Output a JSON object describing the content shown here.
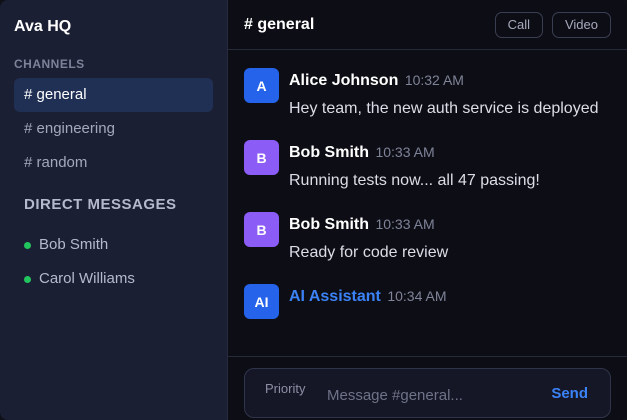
{
  "workspace": {
    "name": "Ava HQ"
  },
  "sidebar": {
    "channels_label": "CHANNELS",
    "channels": [
      {
        "label": "# general",
        "active": true
      },
      {
        "label": "# engineering",
        "active": false
      },
      {
        "label": "# random",
        "active": false
      }
    ],
    "dm_label": "DIRECT MESSAGES",
    "direct_messages": [
      {
        "name": "Bob Smith",
        "status_color": "#22c55e"
      },
      {
        "name": "Carol Williams",
        "status_color": "#22c55e"
      }
    ]
  },
  "header": {
    "title": "# general",
    "call_label": "Call",
    "video_label": "Video"
  },
  "messages": [
    {
      "initials": "A",
      "avatar_color": "#2563eb",
      "author": "Alice Johnson",
      "time": "10:32 AM",
      "text": "Hey team, the new auth service is deployed",
      "is_ai": false
    },
    {
      "initials": "B",
      "avatar_color": "#8b5cf6",
      "author": "Bob Smith",
      "time": "10:33 AM",
      "text": "Running tests now... all 47 passing!",
      "is_ai": false
    },
    {
      "initials": "B",
      "avatar_color": "#8b5cf6",
      "author": "Bob Smith",
      "time": "10:33 AM",
      "text": "Ready for code review",
      "is_ai": false
    },
    {
      "initials": "AI",
      "avatar_color": "#2563eb",
      "author": "AI Assistant",
      "time": "10:34 AM",
      "text": "",
      "is_ai": true
    }
  ],
  "composer": {
    "priority_label": "Priority",
    "placeholder": "Message #general...",
    "value": "",
    "send_label": "Send"
  },
  "colors": {
    "accent": "#3b82f6",
    "sidebar_bg": "#1b1f33",
    "active_channel_bg": "#203055",
    "online": "#22c55e"
  }
}
